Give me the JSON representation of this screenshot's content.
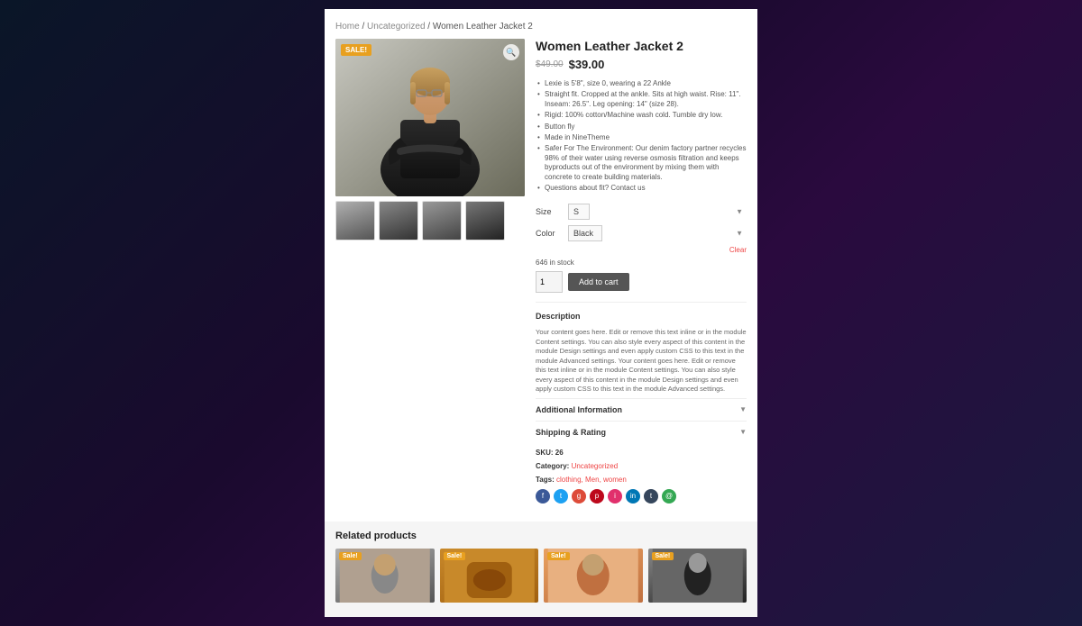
{
  "page": {
    "background": "dark-gradient"
  },
  "breadcrumb": {
    "home": "Home",
    "separator1": " / ",
    "uncategorized": "Uncategorized",
    "separator2": " / ",
    "current": "Women Leather Jacket 2"
  },
  "product": {
    "title": "Women Leather Jacket 2",
    "sale_badge": "SALE!",
    "old_price": "$49.00",
    "new_price": "$39.00",
    "bullets": [
      "Lexie is 5'8\", size 0, wearing a 22 Ankle",
      "Straight fit. Cropped at the ankle. Sits at high waist. Rise: 11\". Inseam: 26.5\". Leg opening: 14\" (size 28).",
      "Rigid: 100% cotton/Machine wash cold. Tumble dry low.",
      "Button fly",
      "Made in NineTheme",
      "Safer For The Environment: Our denim factory partner recycles 98% of their water using reverse osmosis filtration and keeps byproducts out of the environment by mixing them with concrete to create building materials.",
      "Questions about fit? Contact us"
    ],
    "size_label": "Size",
    "size_placeholder": "S",
    "color_label": "Color",
    "color_value": "Black",
    "clear_label": "Clear",
    "stock_text": "646 in stock",
    "qty_value": "1",
    "add_to_cart": "Add to cart",
    "description_title": "Description",
    "description_text": "Your content goes here. Edit or remove this text inline or in the module Content settings. You can also style every aspect of this content in the module Design settings and even apply custom CSS to this text in the module Advanced settings. Your content goes here. Edit or remove this text inline or in the module Content settings. You can also style every aspect of this content in the module Design settings and even apply custom CSS to this text in the module Advanced settings.",
    "additional_info_title": "Additional Information",
    "shipping_title": "Shipping & Rating",
    "sku_label": "SKU:",
    "sku_value": "26",
    "category_label": "Category:",
    "category_value": "Uncategorized",
    "tags_label": "Tags:",
    "tags_value": "clothing, Men, women"
  },
  "social": [
    {
      "name": "facebook",
      "class": "si-fb",
      "icon": "f"
    },
    {
      "name": "twitter",
      "class": "si-tw",
      "icon": "t"
    },
    {
      "name": "google-plus",
      "class": "si-gp",
      "icon": "g"
    },
    {
      "name": "pinterest",
      "class": "si-pi",
      "icon": "p"
    },
    {
      "name": "instagram",
      "class": "si-li",
      "icon": "i"
    },
    {
      "name": "linkedin",
      "class": "si-lk",
      "icon": "in"
    },
    {
      "name": "tumblr",
      "class": "si-tu",
      "icon": "t"
    },
    {
      "name": "email",
      "class": "si-em",
      "icon": "@"
    }
  ],
  "related": {
    "title": "Related products",
    "items": [
      {
        "sale": "Sale!",
        "bg": "ri-1"
      },
      {
        "sale": "Sale!",
        "bg": "ri-2"
      },
      {
        "sale": "Sale!",
        "bg": "ri-3"
      },
      {
        "sale": "Sale!",
        "bg": "ri-4"
      }
    ]
  }
}
